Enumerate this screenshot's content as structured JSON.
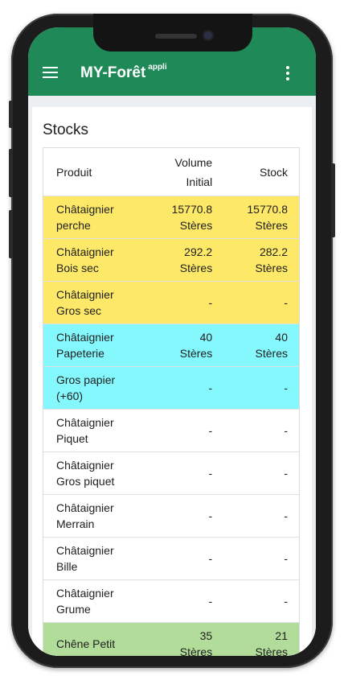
{
  "app": {
    "title": "MY-Forêt",
    "title_sup": "appli"
  },
  "section": {
    "title": "Stocks"
  },
  "table": {
    "headers": {
      "product": "Produit",
      "volume_line1": "Volume",
      "volume_line2": "Initial",
      "stock": "Stock"
    },
    "colors": {
      "yellow": "#fde867",
      "cyan": "#84f8fd",
      "white": "#ffffff",
      "green": "#b2dc9a"
    },
    "rows": [
      {
        "product": [
          "Châtaignier",
          "perche"
        ],
        "volume": [
          "15770.8",
          "Stères"
        ],
        "stock": [
          "15770.8",
          "Stères"
        ],
        "color": "yellow"
      },
      {
        "product": [
          "Châtaignier",
          "Bois sec"
        ],
        "volume": [
          "292.2",
          "Stères"
        ],
        "stock": [
          "282.2",
          "Stères"
        ],
        "color": "yellow"
      },
      {
        "product": [
          "Châtaignier",
          "Gros sec"
        ],
        "volume": [
          "-"
        ],
        "stock": [
          "-"
        ],
        "color": "yellow"
      },
      {
        "product": [
          "Châtaignier",
          "Papeterie"
        ],
        "volume": [
          "40",
          "Stères"
        ],
        "stock": [
          "40",
          "Stères"
        ],
        "color": "cyan"
      },
      {
        "product": [
          "Gros papier",
          "(+60)"
        ],
        "volume": [
          "-"
        ],
        "stock": [
          "-"
        ],
        "color": "cyan"
      },
      {
        "product": [
          "Châtaignier",
          "Piquet"
        ],
        "volume": [
          "-"
        ],
        "stock": [
          "-"
        ],
        "color": "white"
      },
      {
        "product": [
          "Châtaignier",
          "Gros piquet"
        ],
        "volume": [
          "-"
        ],
        "stock": [
          "-"
        ],
        "color": "white"
      },
      {
        "product": [
          "Châtaignier",
          "Merrain"
        ],
        "volume": [
          "-"
        ],
        "stock": [
          "-"
        ],
        "color": "white"
      },
      {
        "product": [
          "Châtaignier",
          "Bille"
        ],
        "volume": [
          "-"
        ],
        "stock": [
          "-"
        ],
        "color": "white"
      },
      {
        "product": [
          "Châtaignier",
          "Grume"
        ],
        "volume": [
          "-"
        ],
        "stock": [
          "-"
        ],
        "color": "white"
      },
      {
        "product": [
          "Chêne Petit"
        ],
        "volume": [
          "35",
          "Stères"
        ],
        "stock": [
          "21",
          "Stères"
        ],
        "color": "green"
      }
    ]
  }
}
